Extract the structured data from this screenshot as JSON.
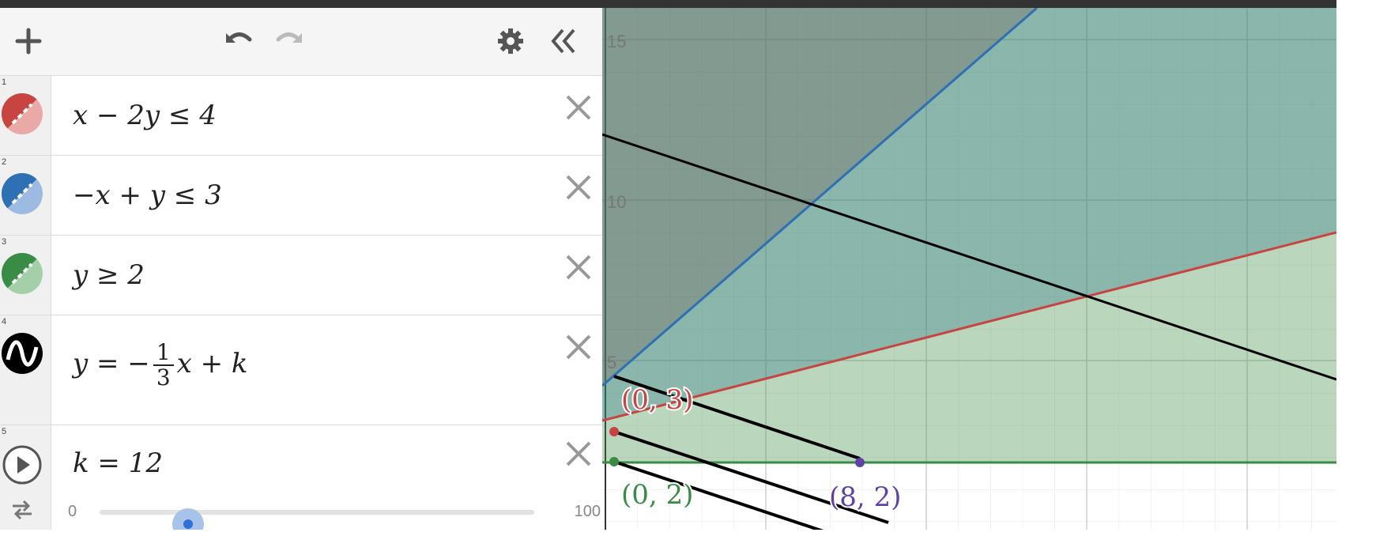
{
  "toolbar": {
    "add_icon": "plus-icon",
    "undo_icon": "undo-icon",
    "redo_icon": "redo-icon",
    "settings_icon": "gear-icon",
    "collapse_icon": "double-chevron-left-icon"
  },
  "expressions": [
    {
      "index": "1",
      "color": "#c74440",
      "parts": [
        "x − 2y ≤ 4"
      ]
    },
    {
      "index": "2",
      "color": "#2d70b3",
      "parts": [
        "−x + y ≤ 3"
      ]
    },
    {
      "index": "3",
      "color": "#388c46",
      "parts": [
        "y ≥ 2"
      ]
    },
    {
      "index": "4",
      "color": "#000000",
      "parts": [
        "y = −",
        "1",
        "3",
        "x + k"
      ]
    },
    {
      "index": "5",
      "color": "#555555",
      "parts": [
        "k = 12"
      ],
      "slider": {
        "min": "0",
        "max": "100",
        "value": 12
      }
    }
  ],
  "graph": {
    "y_ticks": [
      "15",
      "10",
      "5"
    ],
    "point_labels": [
      "(0, 3)",
      "(0, 2)",
      "(8, 2)"
    ],
    "colors": {
      "red": "#c74440",
      "blue": "#2d70b3",
      "green": "#388c46",
      "black": "#000000",
      "purple": "#6042a6"
    }
  }
}
